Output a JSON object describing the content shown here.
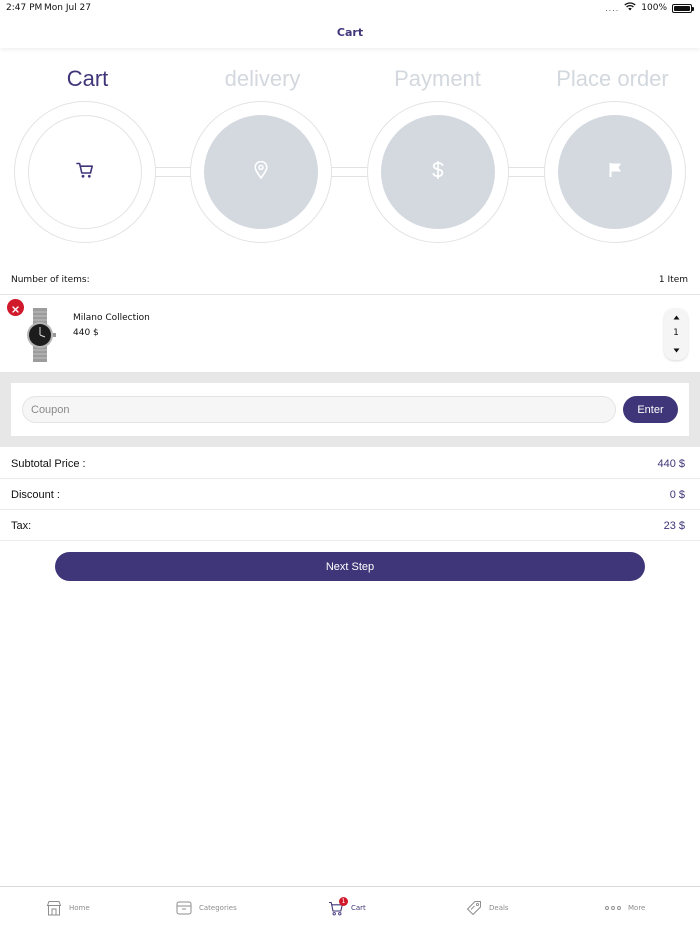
{
  "status_bar": {
    "time": "2:47 PM",
    "date": "Mon Jul 27",
    "signal": "....",
    "battery": "100%"
  },
  "nav": {
    "title": "Cart"
  },
  "steps": [
    {
      "label": "Cart",
      "icon": "cart-icon",
      "active": true
    },
    {
      "label": "delivery",
      "icon": "location-pin-icon",
      "active": false
    },
    {
      "label": "Payment",
      "icon": "dollar-icon",
      "active": false
    },
    {
      "label": "Place order",
      "icon": "flag-icon",
      "active": false
    }
  ],
  "items_summary": {
    "label": "Number of items:",
    "count": "1  Item"
  },
  "cart_items": [
    {
      "name": "Milano Collection",
      "price": "440 $",
      "quantity": "1",
      "image": "wristwatch-image"
    }
  ],
  "coupon": {
    "placeholder": "Coupon",
    "value": "",
    "button": "Enter"
  },
  "summary": {
    "subtotal_label": "Subtotal Price :",
    "subtotal_value": "440 $",
    "discount_label": "Discount :",
    "discount_value": "0 $",
    "tax_label": "Tax:",
    "tax_value": "23 $"
  },
  "next_step": {
    "label": "Next Step"
  },
  "tab_bar": {
    "tabs": [
      {
        "label": "Home",
        "icon": "store-icon",
        "active": false
      },
      {
        "label": "Categories",
        "icon": "categories-box-icon",
        "active": false
      },
      {
        "label": "Cart",
        "icon": "cart-icon",
        "active": true,
        "badge": "1"
      },
      {
        "label": "Deals",
        "icon": "tag-icon",
        "active": false
      },
      {
        "label": "More",
        "icon": "more-dots-icon",
        "active": false
      }
    ]
  },
  "colors": {
    "accent": "#3f3679",
    "inactive_step": "#d3d9df",
    "remove": "#d0192b",
    "coupon_band": "#e7e7e7"
  }
}
